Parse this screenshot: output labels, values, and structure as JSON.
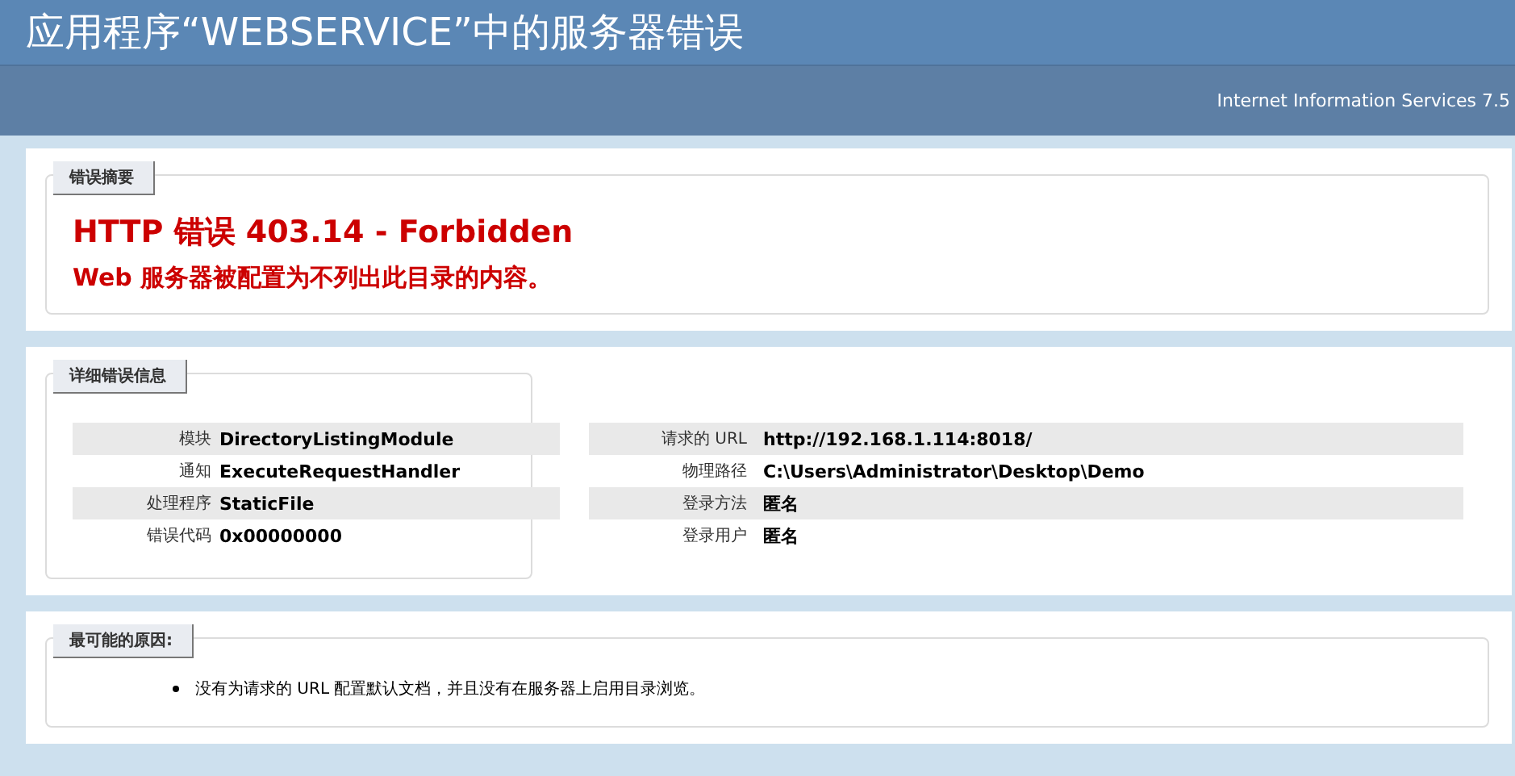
{
  "title": "应用程序“WEBSERVICE”中的服务器错误",
  "server": "Internet Information Services 7.5",
  "sections": [
    {
      "kind": "summary",
      "heading": "错误摘要",
      "error_title": "HTTP 错误 403.14 - Forbidden",
      "message": "Web 服务器被配置为不列出此目录的内容。"
    },
    {
      "kind": "details",
      "heading": "详细错误信息",
      "columns": [
        [
          {
            "label": "模块",
            "value": "DirectoryListingModule"
          },
          {
            "label": "通知",
            "value": "ExecuteRequestHandler"
          },
          {
            "label": "处理程序",
            "value": "StaticFile"
          },
          {
            "label": "错误代码",
            "value": "0x00000000"
          }
        ],
        [
          {
            "label": "请求的 URL",
            "value": "http://192.168.1.114:8018/"
          },
          {
            "label": "物理路径",
            "value": "C:\\Users\\Administrator\\Desktop\\Demo"
          },
          {
            "label": "登录方法",
            "value": "匿名"
          },
          {
            "label": "登录用户",
            "value": "匿名"
          }
        ]
      ]
    },
    {
      "kind": "causes",
      "heading": "最可能的原因:",
      "items": [
        "没有为请求的 URL 配置默认文档，并且没有在服务器上启用目录浏览。"
      ]
    }
  ]
}
